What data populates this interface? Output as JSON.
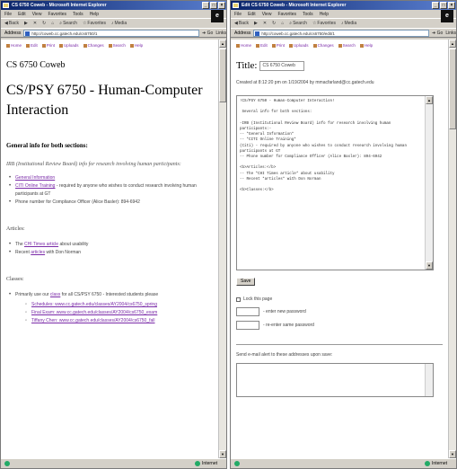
{
  "window1": {
    "title": "CS 6750 Coweb - Microsoft Internet Explorer",
    "menu": [
      "File",
      "Edit",
      "View",
      "Favorites",
      "Tools",
      "Help"
    ],
    "toolbar": [
      "Back",
      "Search",
      "Favorites",
      "Media"
    ],
    "address_label": "Address",
    "address": "http://coweb.cc.gatech.edu/cs6750/1",
    "go_label": "Go",
    "links_label": "Links",
    "nav_links": [
      "Home",
      "Edit",
      "Print",
      "Uploads",
      "Changes",
      "Search",
      "Help"
    ],
    "logo_text": "CS 6750 Coweb",
    "page_title": "CS/PSY 6750 - Human-Computer Interaction",
    "general_heading": "General info for both sections:",
    "irb_italic": "IRB (Institutional Review Board) info for research involving human participants:",
    "irb_items": [
      {
        "link": "General Information",
        "text": ""
      },
      {
        "link": "CITI Online Training",
        "text": " - required by anyone who wishes to conduct research involving human participants at GT"
      },
      {
        "link": "",
        "text": "Phone number for Compliance Officer (Alice Basler): 894-6942"
      }
    ],
    "articles_label": "Articles:",
    "article_items": [
      {
        "pre": "The ",
        "link": "CHI Times article",
        "text": " about usability"
      },
      {
        "pre": "Recent ",
        "link": "articles",
        "text": " with Don Norman"
      }
    ],
    "classes_label": "Classes:",
    "class_items": [
      {
        "pre": "Primarily use our ",
        "link": "class",
        "text": " for all CS/PSY 6750 - Interested students please"
      }
    ],
    "class_sub_items": [
      "Schedules: www.cc.gatech.edu/classes/AY2004/cs6750_spring",
      "Final Exam: www.cc.gatech.edu/classes/AY2004/cs6750_exam",
      "Tiffany Chen: www.cc.gatech.edu/classes/AY2004/cs6750_fall"
    ],
    "status": "Internet"
  },
  "window2": {
    "title": "Edit CS 6750 Coweb - Microsoft Internet Explorer",
    "menu": [
      "File",
      "Edit",
      "View",
      "Favorites",
      "Tools",
      "Help"
    ],
    "toolbar": [
      "Back",
      "Search",
      "Favorites",
      "Media"
    ],
    "address_label": "Address",
    "address": "http://coweb.cc.gatech.edu/cs6750/edit/1",
    "go_label": "Go",
    "links_label": "Links",
    "nav_links": [
      "Home",
      "Edit",
      "Print",
      "Uploads",
      "Changes",
      "Search",
      "Help"
    ],
    "title_label": "Title:",
    "title_value": "CS 6750 Coweb",
    "created_text": "Created at 8:12:20 pm on 1/19/2004 by mmacfarland@cc.gatech.edu",
    "edit_text": "!CS/PSY 6750 - Human-Computer Interaction!\n\n Several info for both sections:\n\n-IRB (Institutional Review Board) info for research involving human participants:-\n-- *General Information*\n-- *CITI Online Training*\n(Citi) - required by anyone who wishes to conduct research involving human participants at GT\n-- Phone number for Compliance Officer (Alice Basler): 894-6942\n\n<b>Articles:</b>\n-- The *CHI Times article* about usability\n-- Recent *articles* with Don Norman\n\n<b>Classes:</b>",
    "save_label": "Save",
    "lock_label": "Lock this page",
    "password_labels": [
      "- enter new password",
      "- re-enter same password"
    ],
    "email_label": "Send e-mail alert to these addresses upon save:",
    "status": "Internet"
  }
}
